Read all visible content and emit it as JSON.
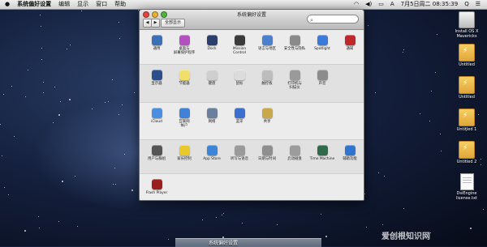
{
  "menubar": {
    "apple": "",
    "app_name": "系统偏好设置",
    "menus": [
      "编辑",
      "显示",
      "窗口",
      "帮助"
    ],
    "status": {
      "clock": "7月5日周二 08:35:39",
      "input_source": "A",
      "search_glyph": "Q"
    }
  },
  "window": {
    "title": "系统偏好设置",
    "show_all": "全部显示",
    "search_placeholder": "",
    "back_glyph": "◀",
    "forward_glyph": "▶",
    "sections": [
      {
        "panes": [
          {
            "label": "通用",
            "icon": "general-icon",
            "color": "#3b6fb6"
          },
          {
            "label": "桌面与\n屏幕保护程序",
            "icon": "desktop-icon",
            "color": "#b44fc0"
          },
          {
            "label": "Dock",
            "icon": "dock-icon",
            "color": "#2a3f6c"
          },
          {
            "label": "Mission\nControl",
            "icon": "mission-control-icon",
            "color": "#3a3a3a"
          },
          {
            "label": "语言与地区",
            "icon": "language-icon",
            "color": "#4b7fd0"
          },
          {
            "label": "安全性与隐私",
            "icon": "security-icon",
            "color": "#8a8a8a"
          },
          {
            "label": "Spotlight",
            "icon": "spotlight-icon",
            "color": "#3b7ad8"
          },
          {
            "label": "通知",
            "icon": "notifications-icon",
            "color": "#c0262a"
          }
        ]
      },
      {
        "panes": [
          {
            "label": "显示器",
            "icon": "displays-icon",
            "color": "#2c4e8a"
          },
          {
            "label": "节能器",
            "icon": "energy-saver-icon",
            "color": "#f0e06a"
          },
          {
            "label": "键盘",
            "icon": "keyboard-icon",
            "color": "#cfcfcf"
          },
          {
            "label": "鼠标",
            "icon": "mouse-icon",
            "color": "#dcdcdc"
          },
          {
            "label": "触控板",
            "icon": "trackpad-icon",
            "color": "#bdbdbd"
          },
          {
            "label": "打印机与\n扫描仪",
            "icon": "printers-icon",
            "color": "#9a9a9a"
          },
          {
            "label": "声音",
            "icon": "sound-icon",
            "color": "#8c8c8c"
          }
        ]
      },
      {
        "panes": [
          {
            "label": "iCloud",
            "icon": "icloud-icon",
            "color": "#4a8ee0"
          },
          {
            "label": "互联网\n帐户",
            "icon": "internet-accounts-icon",
            "color": "#3f83d6"
          },
          {
            "label": "网络",
            "icon": "network-icon",
            "color": "#6a7fa0"
          },
          {
            "label": "蓝牙",
            "icon": "bluetooth-icon",
            "color": "#3a6fd0"
          },
          {
            "label": "共享",
            "icon": "sharing-icon",
            "color": "#c8a84a"
          }
        ]
      },
      {
        "panes": [
          {
            "label": "用户与群组",
            "icon": "users-icon",
            "color": "#555555"
          },
          {
            "label": "家长控制",
            "icon": "parental-controls-icon",
            "color": "#e8c82a"
          },
          {
            "label": "App Store",
            "icon": "app-store-icon",
            "color": "#3b86d8"
          },
          {
            "label": "听写与语音",
            "icon": "dictation-icon",
            "color": "#9a9a9a"
          },
          {
            "label": "日期与时间",
            "icon": "date-time-icon",
            "color": "#8e8e8e"
          },
          {
            "label": "启动磁盘",
            "icon": "startup-disk-icon",
            "color": "#9c9c9c"
          },
          {
            "label": "Time Machine",
            "icon": "time-machine-icon",
            "color": "#2f6b4a"
          },
          {
            "label": "辅助功能",
            "icon": "accessibility-icon",
            "color": "#2f74d0"
          }
        ]
      },
      {
        "panes": [
          {
            "label": "Flash Player",
            "icon": "flash-player-icon",
            "color": "#9a1e1e"
          }
        ]
      }
    ]
  },
  "desktop": {
    "icons": [
      {
        "label": "Install OS X\nMavericks",
        "icon": "installer-disk-icon"
      },
      {
        "label": "Untitled",
        "icon": "usb-drive-icon"
      },
      {
        "label": "Untitled",
        "icon": "usb-drive-icon"
      },
      {
        "label": "Untitled 1",
        "icon": "usb-drive-icon"
      },
      {
        "label": "Untitled 2",
        "icon": "usb-drive-icon"
      },
      {
        "label": "DsiEngine\nlicense.txt",
        "icon": "text-document-icon"
      }
    ]
  },
  "dock": {
    "label": "系统偏好设置"
  },
  "watermark": "爱创根知识网"
}
